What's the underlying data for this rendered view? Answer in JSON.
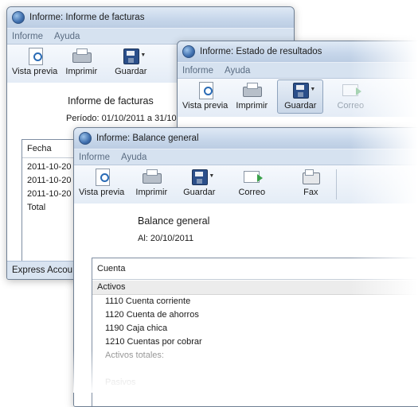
{
  "windows": {
    "facturas": {
      "title": "Informe: Informe de facturas",
      "menu": [
        "Informe",
        "Ayuda"
      ],
      "toolbar": [
        "Vista previa",
        "Imprimir",
        "Guardar"
      ],
      "report_title": "Informe de facturas",
      "period": "Período: 01/10/2011 a 31/10",
      "column_header": "Fecha",
      "rows": [
        "2011-10-20",
        "2011-10-20",
        "2011-10-20",
        "Total"
      ],
      "status": "Express Accou"
    },
    "resultados": {
      "title": "Informe: Estado de resultados",
      "menu": [
        "Informe",
        "Ayuda"
      ],
      "toolbar": [
        "Vista previa",
        "Imprimir",
        "Guardar",
        "Correo"
      ]
    },
    "balance": {
      "title": "Informe: Balance general",
      "menu": [
        "Informe",
        "Ayuda"
      ],
      "toolbar": [
        "Vista previa",
        "Imprimir",
        "Guardar",
        "Correo",
        "Fax"
      ],
      "report_title": "Balance general",
      "date": "Al: 20/10/2011",
      "column_header": "Cuenta",
      "section_assets": "Activos",
      "assets": [
        "1110 Cuenta corriente",
        "1120 Cuenta de ahorros",
        "1190 Caja chica",
        "1210 Cuentas por cobrar"
      ],
      "assets_total": "Activos totales:",
      "section_liabilities": "Pasivos"
    }
  },
  "icons": {
    "preview": "preview-icon",
    "print": "printer-icon",
    "save": "save-disk-icon",
    "mail": "mail-icon",
    "fax": "fax-icon",
    "app": "app-globe-icon"
  },
  "colors": {
    "titlebar": "#c6d6ea",
    "menubar_text": "#5a6c82",
    "section_row": "#ececec"
  }
}
